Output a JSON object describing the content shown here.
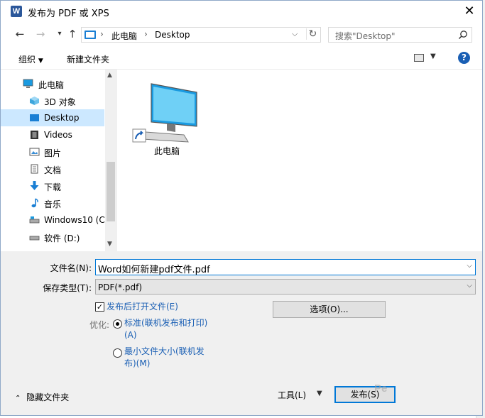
{
  "window": {
    "title": "发布为 PDF 或 XPS",
    "app_icon_letter": "W"
  },
  "nav": {
    "address_parts": [
      "此电脑",
      "Desktop"
    ],
    "search_placeholder": "搜索\"Desktop\""
  },
  "toolbar": {
    "organize_label": "组织",
    "new_folder_label": "新建文件夹"
  },
  "sidebar": {
    "items": [
      {
        "label": "此电脑",
        "icon": "computer-icon"
      },
      {
        "label": "3D 对象",
        "icon": "cube-icon"
      },
      {
        "label": "Desktop",
        "icon": "desktop-icon",
        "selected": true
      },
      {
        "label": "Videos",
        "icon": "film-icon"
      },
      {
        "label": "图片",
        "icon": "picture-icon"
      },
      {
        "label": "文档",
        "icon": "document-icon"
      },
      {
        "label": "下载",
        "icon": "download-icon"
      },
      {
        "label": "音乐",
        "icon": "music-icon"
      },
      {
        "label": "Windows10 (C:",
        "icon": "drive-icon"
      },
      {
        "label": "软件 (D:)",
        "icon": "drive-icon"
      }
    ]
  },
  "content": {
    "items": [
      {
        "label": "此电脑",
        "icon": "computer-shortcut-icon"
      }
    ]
  },
  "form": {
    "filename_label": "文件名(N):",
    "filename_value": "Word如何新建pdf文件.pdf",
    "filetype_label": "保存类型(T):",
    "filetype_value": "PDF(*.pdf)",
    "open_after_label": "发布后打开文件(E)",
    "open_after_checked": true,
    "optimize_label": "优化:",
    "opt_standard_line1": "标准(联机发布和打印)",
    "opt_standard_line2": "(A)",
    "opt_min_line1": "最小文件大小(联机发",
    "opt_min_line2": "布)(M)",
    "options_button": "选项(O)..."
  },
  "footer": {
    "hide_folders_label": "隐藏文件夹",
    "tools_label": "工具(L)",
    "publish_label": "发布(S)"
  },
  "colors": {
    "accent": "#0078d7",
    "link": "#1a5fb4",
    "selected_bg": "#cce8ff",
    "word_blue": "#2b579a"
  }
}
